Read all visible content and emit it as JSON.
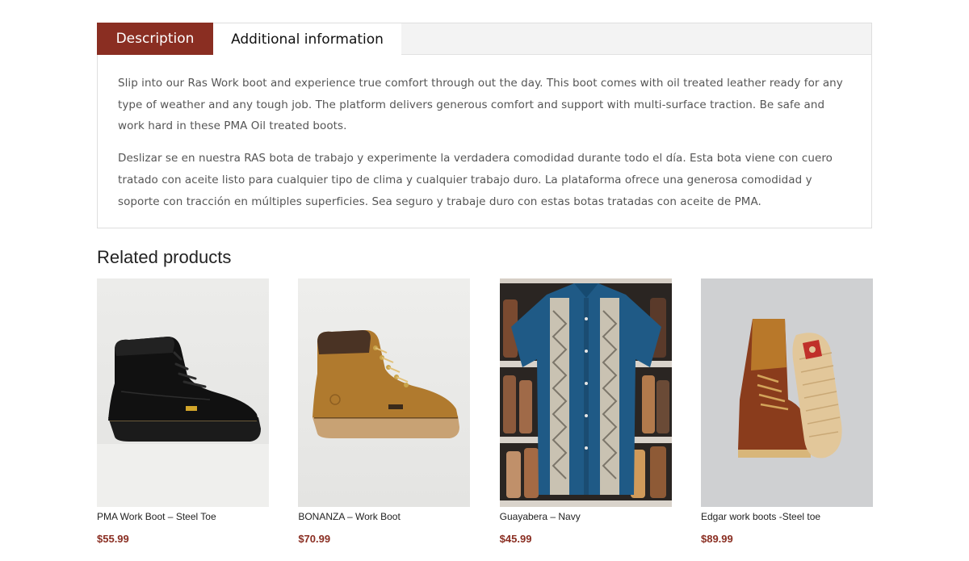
{
  "tabs": {
    "items": [
      {
        "label": "Description"
      },
      {
        "label": "Additional information"
      }
    ],
    "description": {
      "paragraphs": [
        "Slip into our Ras Work boot and experience true comfort through out the day. This boot comes with oil treated leather ready for any type of weather and any tough job. The platform delivers generous comfort and support with multi-surface traction. Be safe and work hard in these PMA Oil treated boots.",
        "Deslizar se en nuestra RAS bota de trabajo y experimente la verdadera comodidad durante todo el día. Esta bota viene con cuero tratado con aceite listo para cualquier tipo de clima y cualquier trabajo duro. La plataforma ofrece una generosa comodidad y soporte con tracción en múltiples superficies. Sea seguro y trabaje duro con estas botas tratadas con aceite de PMA."
      ]
    }
  },
  "related": {
    "title": "Related products",
    "products": [
      {
        "name": "PMA Work Boot – Steel Toe",
        "price": "$55.99",
        "image": "black-work-boot-photo"
      },
      {
        "name": "BONANZA – Work Boot",
        "price": "$70.99",
        "image": "tan-nubuck-work-boot-photo"
      },
      {
        "name": "Guayabera – Navy",
        "price": "$45.99",
        "image": "navy-guayabera-shirt-photo"
      },
      {
        "name": "Edgar work boots -Steel toe",
        "price": "$89.99",
        "image": "brown-leather-work-boots-photo"
      }
    ]
  },
  "colors": {
    "accent": "#8a2e22",
    "tab_bar_bg": "#f3f3f3",
    "border": "#dedede"
  }
}
